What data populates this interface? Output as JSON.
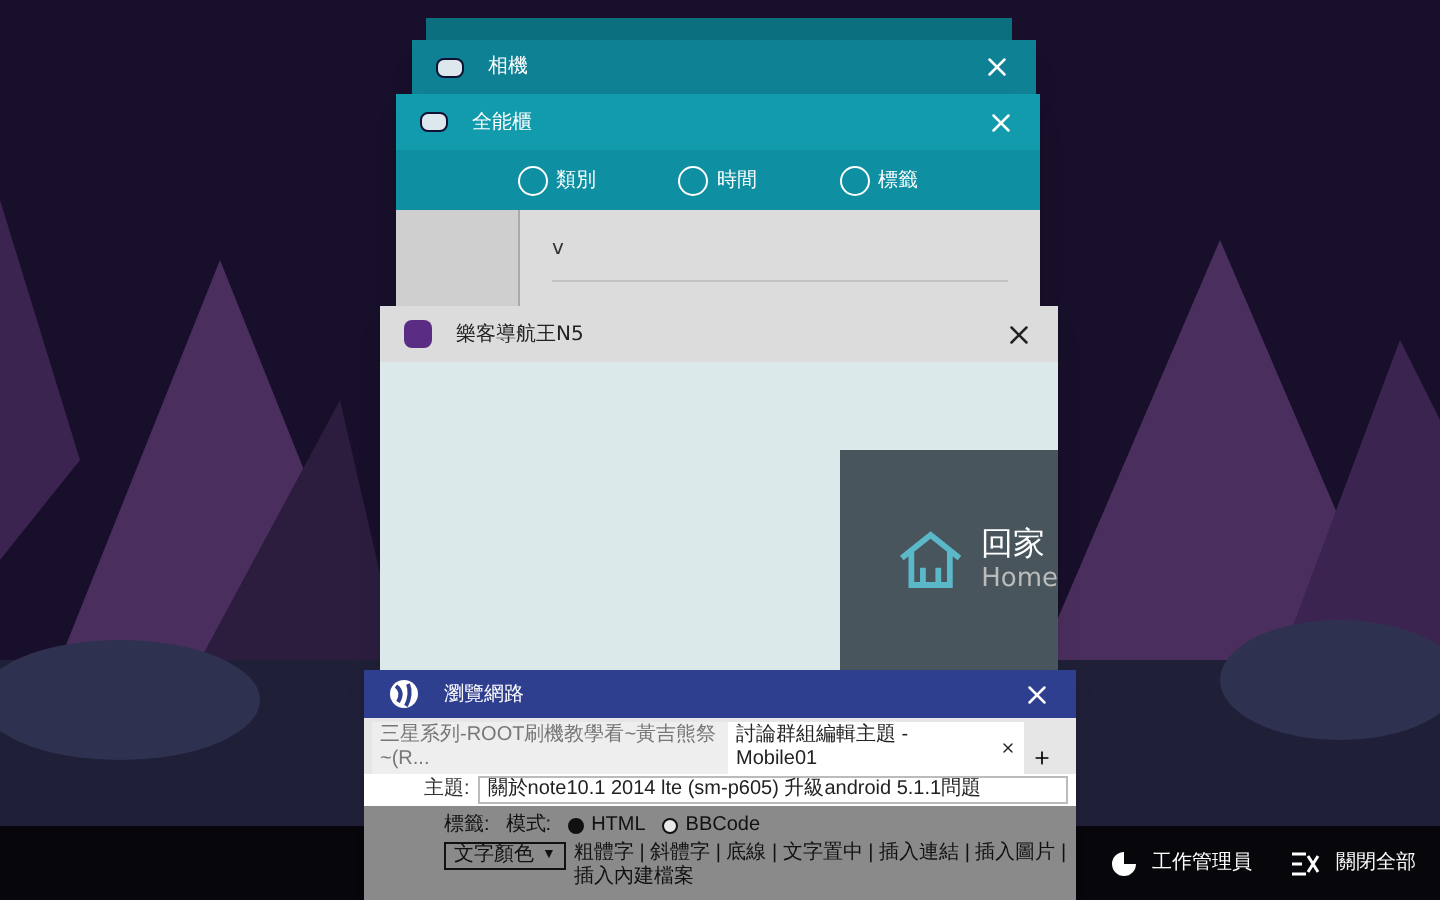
{
  "recent_apps": [
    {
      "kind": "sliver"
    },
    {
      "kind": "blank",
      "title": "相機"
    },
    {
      "kind": "organizer",
      "title": "全能櫃",
      "tabs": [
        {
          "label": "類別"
        },
        {
          "label": "時間"
        },
        {
          "label": "標籤"
        }
      ],
      "list_item": "v"
    },
    {
      "kind": "navigator",
      "title": "樂客導航王N5",
      "home_label": "回家",
      "home_sublabel": "Home"
    },
    {
      "kind": "browser",
      "title": "瀏覽網路",
      "tabs": [
        {
          "label": "三星系列-ROOT刷機教學看~黃吉熊祭~(R...",
          "selected": false
        },
        {
          "label": "討論群組編輯主題 - Mobile01",
          "selected": true
        }
      ],
      "subject_label": "主題:",
      "subject_value": "關於note10.1 2014 lte (sm-p605) 升級android 5.1.1問題",
      "tag_label": "標籤:",
      "mode_label": "模式:",
      "modes": [
        {
          "label": "HTML",
          "selected": true
        },
        {
          "label": "BBCode",
          "selected": false
        }
      ],
      "color_select": "文字顏色",
      "color_select_caret": "▼",
      "toolbar": "粗體字 | 斜體字 | 底線 | 文字置中 | 插入連結 | 插入圖片 | 插入內建檔案"
    }
  ],
  "bottom_bar": {
    "task_manager": "工作管理員",
    "close_all": "關閉全部"
  }
}
